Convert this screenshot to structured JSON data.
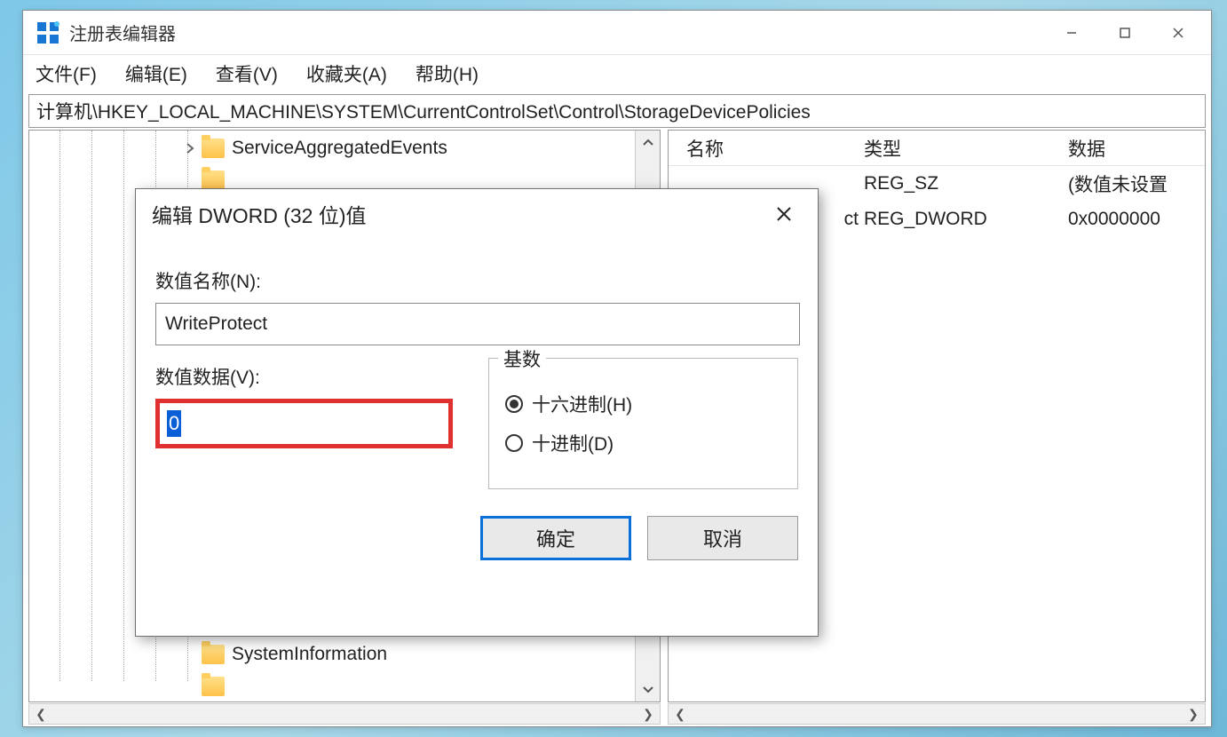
{
  "window": {
    "title": "注册表编辑器"
  },
  "menu": {
    "file": "文件(F)",
    "edit": "编辑(E)",
    "view": "查看(V)",
    "favorites": "收藏夹(A)",
    "help": "帮助(H)"
  },
  "address": "计算机\\HKEY_LOCAL_MACHINE\\SYSTEM\\CurrentControlSet\\Control\\StorageDevicePolicies",
  "tree": {
    "top_item": "ServiceAggregatedEvents",
    "bottom_item": "SystemInformation",
    "trailing_fragment": "ct"
  },
  "values_header": {
    "name": "名称",
    "type": "类型",
    "data": "数据"
  },
  "values_rows": [
    {
      "type": "REG_SZ",
      "data": "(数值未设置"
    },
    {
      "type": "REG_DWORD",
      "data": "0x0000000"
    }
  ],
  "dialog": {
    "title": "编辑 DWORD (32 位)值",
    "name_label": "数值名称(N):",
    "name_value": "WriteProtect",
    "data_label": "数值数据(V):",
    "data_value": "0",
    "base_group": "基数",
    "radio_hex": "十六进制(H)",
    "radio_dec": "十进制(D)",
    "ok": "确定",
    "cancel": "取消"
  }
}
